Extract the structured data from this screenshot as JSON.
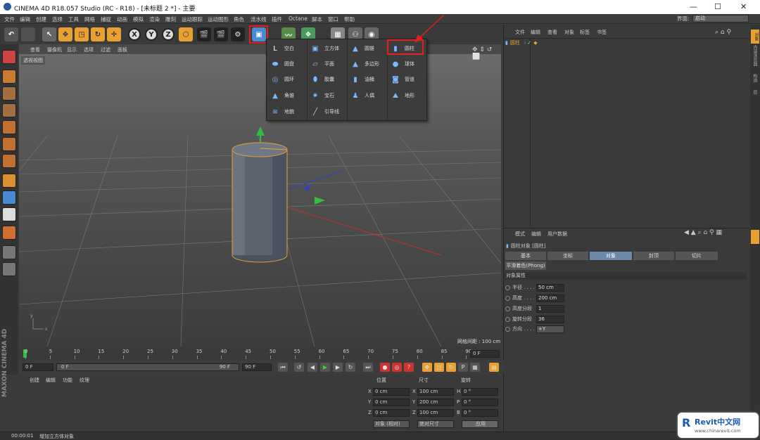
{
  "window": {
    "title": "CINEMA 4D R18.057 Studio (RC - R18) - [未标题 2 *] - 主要",
    "min": "—",
    "max": "☐",
    "close": "✕"
  },
  "menu": [
    "文件",
    "编辑",
    "创建",
    "选择",
    "工具",
    "网格",
    "捕捉",
    "动画",
    "模拟",
    "渲染",
    "雕刻",
    "运动跟踪",
    "运动图形",
    "角色",
    "流水线",
    "插件",
    "Octane",
    "脚本",
    "窗口",
    "帮助"
  ],
  "layout": {
    "label": "界面:",
    "value": "启动"
  },
  "toolbar": {
    "axis": [
      "X",
      "Y",
      "Z"
    ]
  },
  "viewport": {
    "menu": [
      "查看",
      "摄像机",
      "显示",
      "选项",
      "过滤",
      "面板"
    ],
    "label": "透视视图",
    "grid_spacing": "网格间距 : 100 cm"
  },
  "primitives_popup": {
    "items": [
      {
        "label": "空白",
        "icon": "null-icon"
      },
      {
        "label": "立方体",
        "icon": "cube-icon"
      },
      {
        "label": "圆锥",
        "icon": "cone-icon"
      },
      {
        "label": "圆柱",
        "icon": "cylinder-icon"
      },
      {
        "label": "圆盘",
        "icon": "disc-icon"
      },
      {
        "label": "平面",
        "icon": "plane-icon"
      },
      {
        "label": "多边形",
        "icon": "polygon-icon"
      },
      {
        "label": "球体",
        "icon": "sphere-icon"
      },
      {
        "label": "圆环",
        "icon": "torus-icon"
      },
      {
        "label": "胶囊",
        "icon": "capsule-icon"
      },
      {
        "label": "油桶",
        "icon": "oil-tank-icon"
      },
      {
        "label": "管道",
        "icon": "tube-icon"
      },
      {
        "label": "角锥",
        "icon": "pyramid-icon"
      },
      {
        "label": "宝石",
        "icon": "platonic-icon"
      },
      {
        "label": "人偶",
        "icon": "figure-icon"
      },
      {
        "label": "地形",
        "icon": "landscape-icon"
      },
      {
        "label": "地貌",
        "icon": "relief-icon"
      },
      {
        "label": "引导线",
        "icon": "guide-icon"
      }
    ]
  },
  "object_manager": {
    "menu": [
      "文件",
      "编辑",
      "查看",
      "对象",
      "标签",
      "书签"
    ],
    "object": "圆柱"
  },
  "attribute_manager": {
    "menu": [
      "模式",
      "编辑",
      "用户数据"
    ],
    "title": "圆柱对象 [圆柱]",
    "tabs": [
      "基本",
      "坐标",
      "对象",
      "封顶",
      "切片"
    ],
    "phong": "平滑着色(Phong)",
    "section": "对象属性",
    "params": [
      {
        "label": "半径 . . . . .",
        "value": "50 cm"
      },
      {
        "label": "高度 . . . . .",
        "value": "200 cm"
      },
      {
        "label": "高度分段",
        "value": "1"
      },
      {
        "label": "旋转分段",
        "value": "36"
      },
      {
        "label": "方向 . . . . .",
        "value": "+Y"
      }
    ]
  },
  "side_tabs": [
    "对象",
    "内容浏览器",
    "构造",
    "层"
  ],
  "timeline": {
    "ticks": [
      "0",
      "5",
      "10",
      "15",
      "20",
      "25",
      "30",
      "35",
      "40",
      "45",
      "50",
      "55",
      "60",
      "65",
      "70",
      "75",
      "80",
      "85",
      "90"
    ],
    "current": "0 F"
  },
  "animation": {
    "start": "0 F",
    "range_start": "0 F",
    "range_end": "90 F",
    "end": "90 F"
  },
  "material_manager": {
    "menu": [
      "创建",
      "编辑",
      "功能",
      "纹理"
    ]
  },
  "coordinates": {
    "headers": [
      "位置",
      "尺寸",
      "旋转"
    ],
    "rows": [
      {
        "axis": "X",
        "pos": "0 cm",
        "size": "100 cm",
        "rl": "H",
        "rot": "0 °"
      },
      {
        "axis": "Y",
        "pos": "0 cm",
        "size": "200 cm",
        "rl": "P",
        "rot": "0 °"
      },
      {
        "axis": "Z",
        "pos": "0 cm",
        "size": "100 cm",
        "rl": "B",
        "rot": "0 °"
      }
    ],
    "mode": "对象 (相对)",
    "size_mode": "绝对尺寸",
    "apply": "应用"
  },
  "status": {
    "time": "00:00:01",
    "message": "增加立方体对象"
  },
  "brand": "MAXON CINEMA 4D",
  "watermark": {
    "title": "Revit中文网",
    "url": "www.chinarevit.com"
  }
}
